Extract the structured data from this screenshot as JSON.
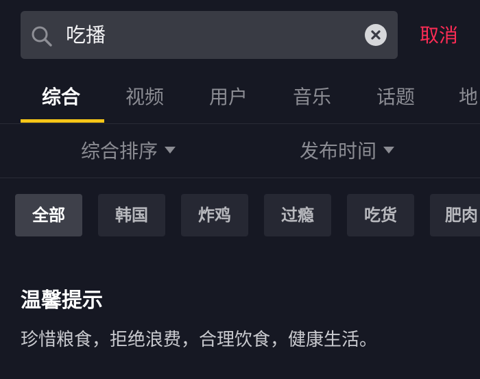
{
  "search": {
    "query": "吃播",
    "search_icon": "search-icon",
    "clear_icon": "clear-icon",
    "cancel_label": "取消"
  },
  "tabs": [
    {
      "label": "综合",
      "active": true
    },
    {
      "label": "视频",
      "active": false
    },
    {
      "label": "用户",
      "active": false
    },
    {
      "label": "音乐",
      "active": false
    },
    {
      "label": "话题",
      "active": false
    },
    {
      "label": "地",
      "active": false
    }
  ],
  "filters": {
    "sort_label": "综合排序",
    "time_label": "发布时间",
    "dropdown_icon": "caret-down-icon"
  },
  "chips": [
    {
      "label": "全部",
      "active": true
    },
    {
      "label": "韩国",
      "active": false
    },
    {
      "label": "炸鸡",
      "active": false
    },
    {
      "label": "过瘾",
      "active": false
    },
    {
      "label": "吃货",
      "active": false
    },
    {
      "label": "肥肉",
      "active": false
    }
  ],
  "notice": {
    "title": "温馨提示",
    "text": "珍惜粮食，拒绝浪费，合理饮食，健康生活。"
  },
  "colors": {
    "background": "#161823",
    "accent_red": "#fe2c55",
    "tab_indicator": "#f5c518"
  }
}
